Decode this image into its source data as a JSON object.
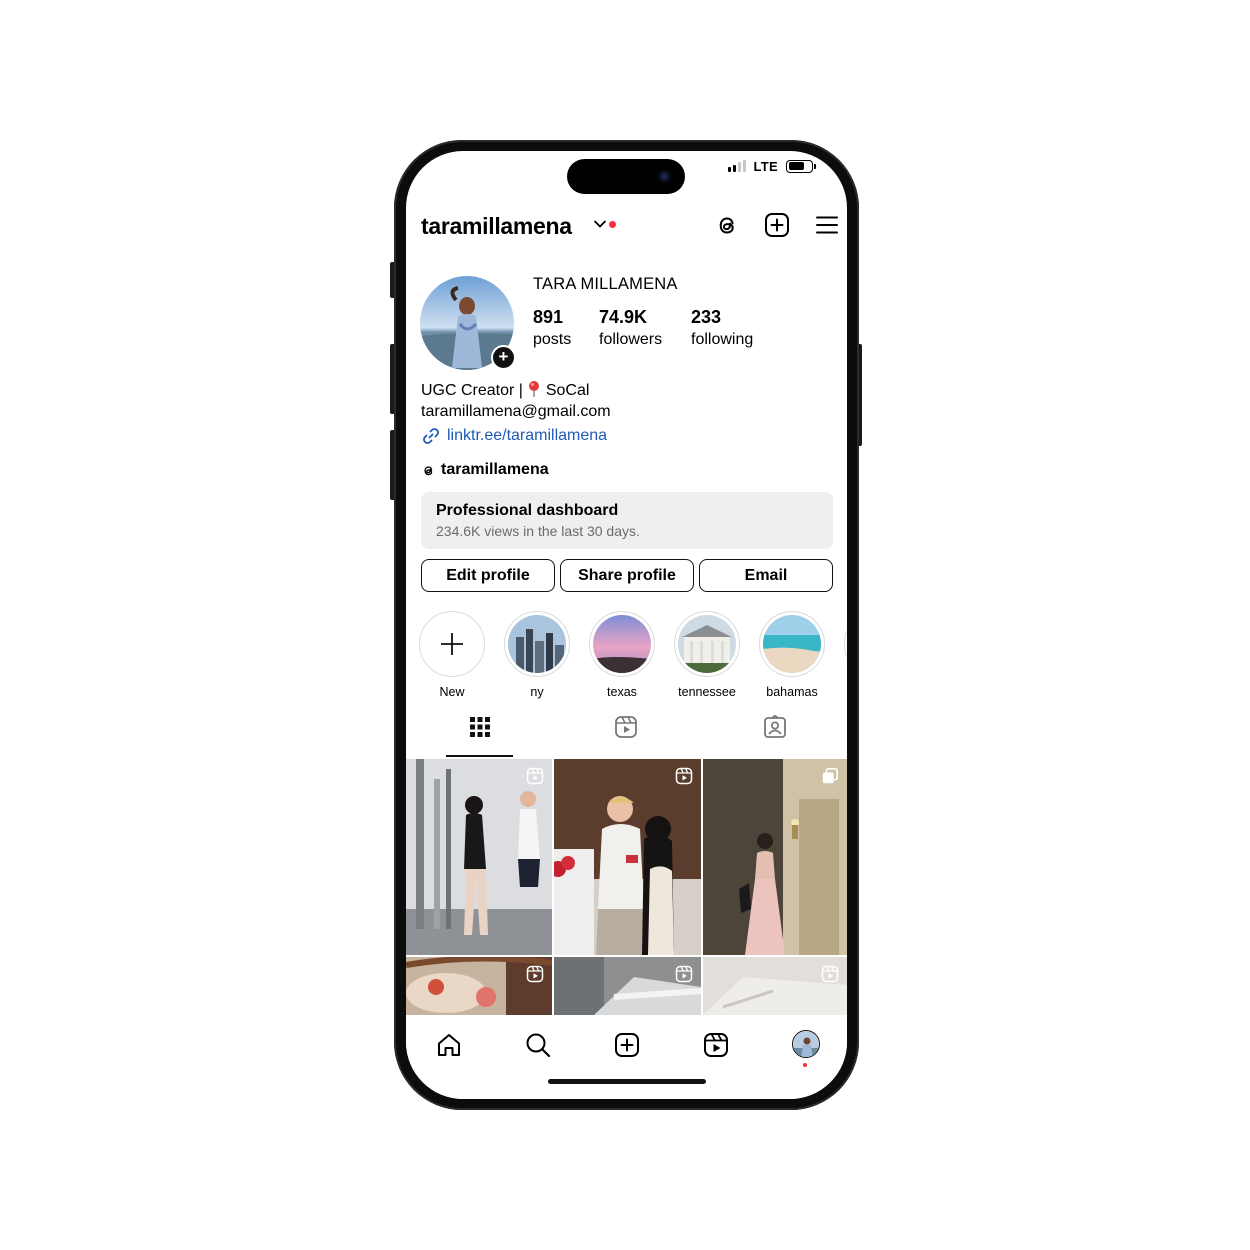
{
  "status_bar": {
    "network": "LTE"
  },
  "header": {
    "username": "taramillamena",
    "icons": [
      "threads-icon",
      "create-icon",
      "menu-icon"
    ]
  },
  "profile": {
    "full_name": "TARA MILLAMENA",
    "stats": [
      {
        "num": "891",
        "label": "posts"
      },
      {
        "num": "74.9K",
        "label": "followers"
      },
      {
        "num": "233",
        "label": "following"
      }
    ],
    "bio_line1_prefix": "UGC Creator |",
    "bio_line1_suffix": "SoCal",
    "bio_line2": "taramillamena@gmail.com",
    "link": "linktr.ee/taramillamena",
    "threads_handle": "taramillamena"
  },
  "dashboard": {
    "title": "Professional dashboard",
    "subtitle": "234.6K views in the last 30 days."
  },
  "buttons": {
    "edit": "Edit profile",
    "share": "Share profile",
    "email": "Email"
  },
  "highlights": [
    {
      "label": "New"
    },
    {
      "label": "ny"
    },
    {
      "label": "texas"
    },
    {
      "label": "tennessee"
    },
    {
      "label": "bahamas"
    }
  ],
  "tabs": [
    "grid-icon",
    "reels-icon",
    "tagged-icon"
  ],
  "grid_badges": [
    "reel-icon",
    "reel-icon",
    "carousel-icon",
    "reel-icon",
    "reel-icon",
    "reel-icon"
  ],
  "bottom_nav": [
    "home-icon",
    "search-icon",
    "create-icon",
    "reels-icon",
    "profile-avatar"
  ],
  "colors": {
    "link": "#1e5bb8",
    "notification": "#ff2d3c",
    "dashboard_bg": "#efefef"
  }
}
